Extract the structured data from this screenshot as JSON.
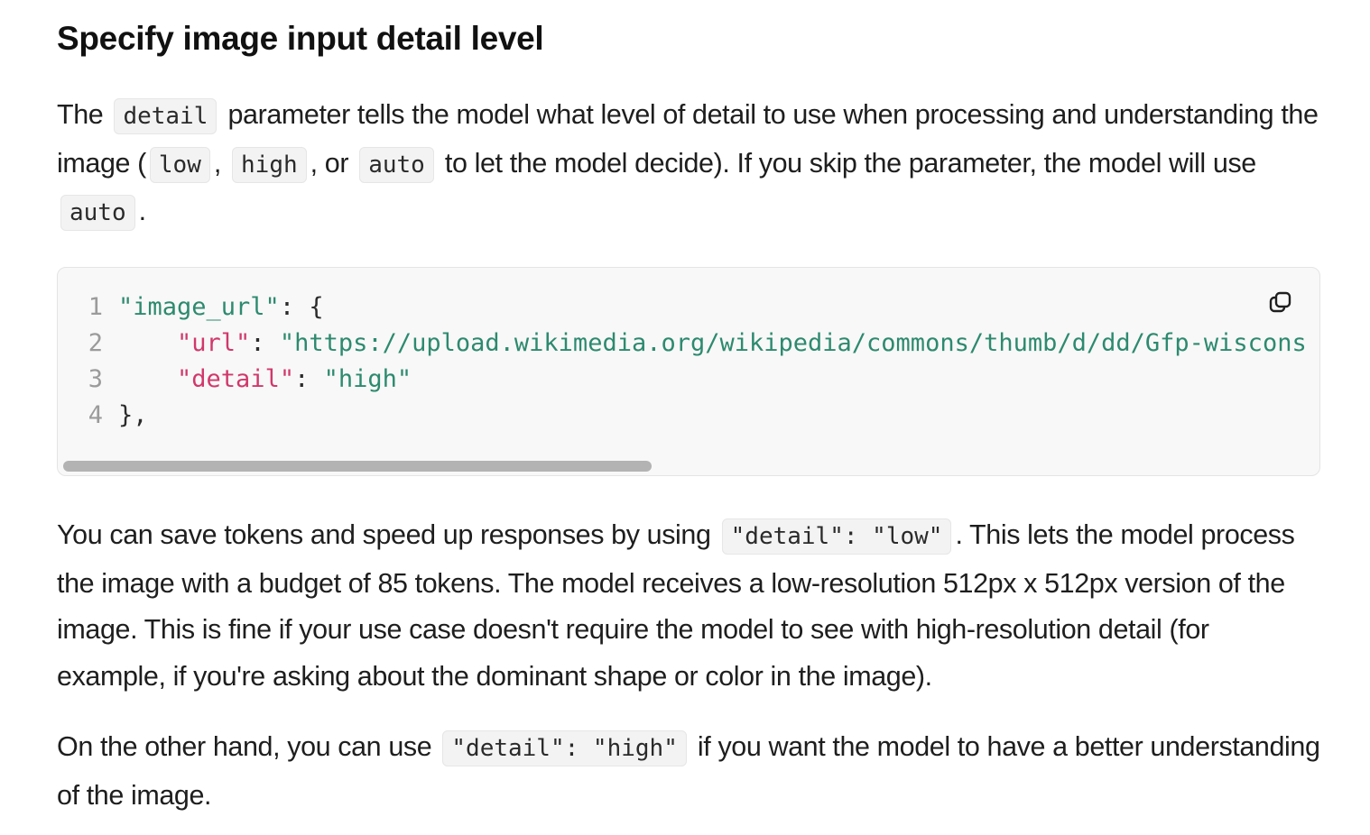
{
  "heading": "Specify image input detail level",
  "para1": {
    "t1": "The",
    "code_detail": "detail",
    "t2": "parameter tells the model what level of detail to use when processing and understanding the image (",
    "code_low": "low",
    "t3": ",",
    "code_high": "high",
    "t4": ", or",
    "code_auto": "auto",
    "t5": "to let the model decide). If you skip the parameter, the model will use",
    "code_auto2": "auto",
    "t6": "."
  },
  "code_block": {
    "lines": [
      {
        "number": "1",
        "tokens": [
          {
            "text": "\"image_url\"",
            "kind": "key"
          },
          {
            "text": ": {",
            "kind": "punc"
          }
        ]
      },
      {
        "number": "2",
        "tokens": [
          {
            "text": "    ",
            "kind": "punc"
          },
          {
            "text": "\"url\"",
            "kind": "key-alt"
          },
          {
            "text": ": ",
            "kind": "punc"
          },
          {
            "text": "\"https://upload.wikimedia.org/wikipedia/commons/thumb/d/dd/Gfp-wiscons",
            "kind": "str"
          }
        ]
      },
      {
        "number": "3",
        "tokens": [
          {
            "text": "    ",
            "kind": "punc"
          },
          {
            "text": "\"detail\"",
            "kind": "key-alt"
          },
          {
            "text": ": ",
            "kind": "punc"
          },
          {
            "text": "\"high\"",
            "kind": "str"
          }
        ]
      },
      {
        "number": "4",
        "tokens": [
          {
            "text": "},",
            "kind": "punc"
          }
        ]
      }
    ],
    "copy_icon": "copy-icon",
    "scroll_position": 0,
    "scroll_visible_fraction": 0.47
  },
  "para2": {
    "t1": "You can save tokens and speed up responses by using",
    "code": "\"detail\": \"low\"",
    "t2": ". This lets the model process the image with a budget of 85 tokens. The model receives a low-resolution 512px x 512px version of the image. This is fine if your use case doesn't require the model to see with high-resolution detail (for example, if you're asking about the dominant shape or color in the image)."
  },
  "para3": {
    "t1": "On the other hand, you can use",
    "code": "\"detail\": \"high\"",
    "t2": "if you want the model to have a better understanding of the image."
  },
  "colors": {
    "key": "#2d8a6e",
    "key_alt": "#d1386b",
    "string": "#2d8a6e",
    "line_number": "#9b9b9b",
    "code_bg": "#f8f8f8",
    "scroll_thumb": "#b3b3b3"
  }
}
